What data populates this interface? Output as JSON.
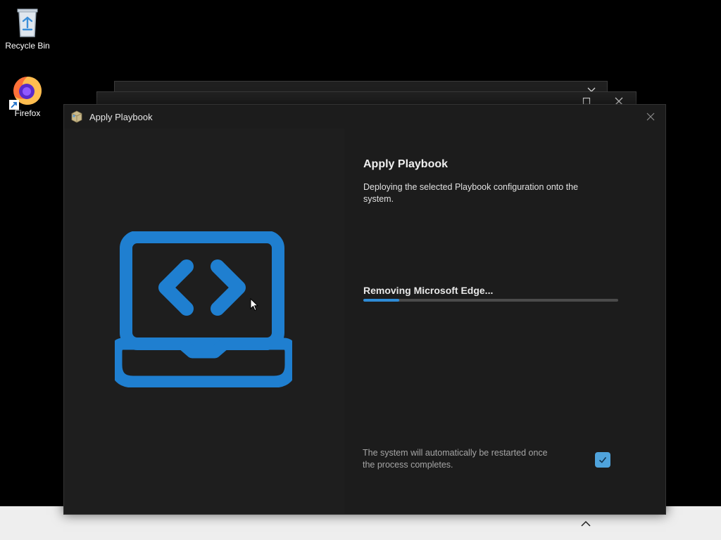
{
  "desktop": {
    "icons": [
      {
        "label": "Recycle Bin",
        "icon": "recycle-bin-icon"
      },
      {
        "label": "Firefox",
        "icon": "firefox-icon"
      }
    ]
  },
  "window": {
    "title": "Apply Playbook",
    "app_icon": "package-icon",
    "close_icon": "close-icon"
  },
  "content": {
    "heading": "Apply Playbook",
    "description": "Deploying the selected Playbook configuration onto the system.",
    "status": "Removing Microsoft Edge...",
    "progress": 0.14,
    "restart_note": "The system will automatically be restarted once the process completes.",
    "restart_checked": true,
    "hero_icon": "laptop-code-icon"
  },
  "colors": {
    "accent": "#2e8bd6",
    "hero": "#1f7fd0",
    "checkbox": "#4fa3dc",
    "window_bg": "#1c1c1c"
  }
}
